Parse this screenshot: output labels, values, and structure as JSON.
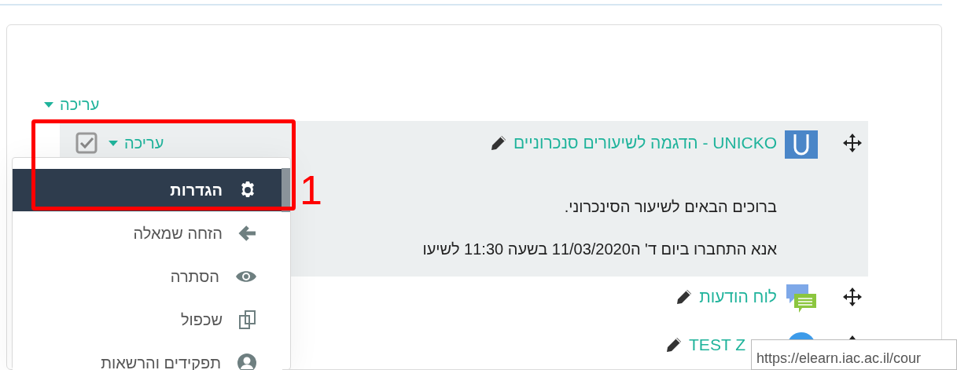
{
  "section_menu": {
    "label": "עריכה"
  },
  "activities": [
    {
      "kind": "unicko",
      "title": "UNICKO - הדגמה לשיעורים סנכרוניים",
      "highlighted": true,
      "edit_menu": {
        "label": "עריכה"
      },
      "description": [
        "ברוכים הבאים לשיעור הסינכרוני.",
        "אנא התחברו ביום ד' ה11/03/2020 בשעה 11:30 לשיעו"
      ]
    },
    {
      "kind": "forum",
      "title": "לוח הודעות",
      "highlighted": false
    },
    {
      "kind": "zoom",
      "title": "TEST Z",
      "highlighted": false
    }
  ],
  "dropdown": {
    "items": [
      {
        "kind": "gear",
        "label": "הגדרות",
        "selected": true
      },
      {
        "kind": "arrow",
        "label": "הזחה שמאלה",
        "selected": false
      },
      {
        "kind": "eye",
        "label": "הסתרה",
        "selected": false
      },
      {
        "kind": "copy",
        "label": "שכפול",
        "selected": false
      },
      {
        "kind": "user",
        "label": "תפקידים והרשאות",
        "selected": false
      }
    ]
  },
  "annotation": {
    "label": "1"
  },
  "tooltip": {
    "text": "https://elearn.iac.ac.il/cour"
  }
}
